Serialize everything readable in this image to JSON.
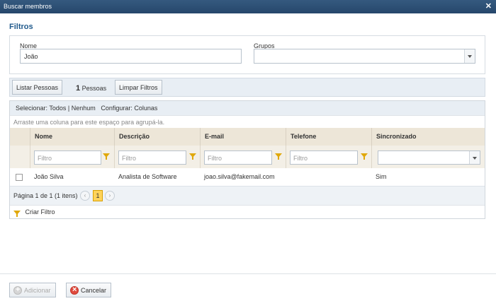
{
  "window": {
    "title": "Buscar membros"
  },
  "filters": {
    "title": "Filtros",
    "nome_label": "Nome",
    "nome_value": "João",
    "grupos_label": "Grupos",
    "grupos_value": ""
  },
  "toolbar": {
    "list_button": "Listar Pessoas",
    "count": "1",
    "count_label": "Pessoas",
    "clear_button": "Limpar Filtros"
  },
  "grid": {
    "select_label": "Selecionar:",
    "select_all": "Todos",
    "separator": "|",
    "select_none": "Nenhum",
    "configure_label": "Configurar:",
    "columns_link": "Colunas",
    "group_hint": "Arraste uma coluna para este espaço para agrupá-la.",
    "columns": [
      "Nome",
      "Descrição",
      "E-mail",
      "Telefone",
      "Sincronizado"
    ],
    "filter_placeholder": "Filtro",
    "rows": [
      {
        "nome": "João Silva",
        "descricao": "Analista de Software",
        "email": "joao.silva@fakemail.com",
        "telefone": "",
        "sincronizado": "Sim"
      }
    ],
    "pager_text": "Página 1 de 1 (1 itens)",
    "prev": "‹",
    "current_page": "1",
    "next": "›",
    "create_filter": "Criar Filtro"
  },
  "footer": {
    "add_button": "Adicionar",
    "cancel_button": "Cancelar"
  },
  "colors": {
    "titlebar": "#2c4f76",
    "accent": "#215a8c",
    "header": "#ede6d8",
    "funnel": "#e0a80a",
    "page_active": "#ffd35a"
  },
  "icons": [
    "close-icon",
    "funnel-icon",
    "add-icon",
    "cancel-icon",
    "chevron-down-icon"
  ]
}
